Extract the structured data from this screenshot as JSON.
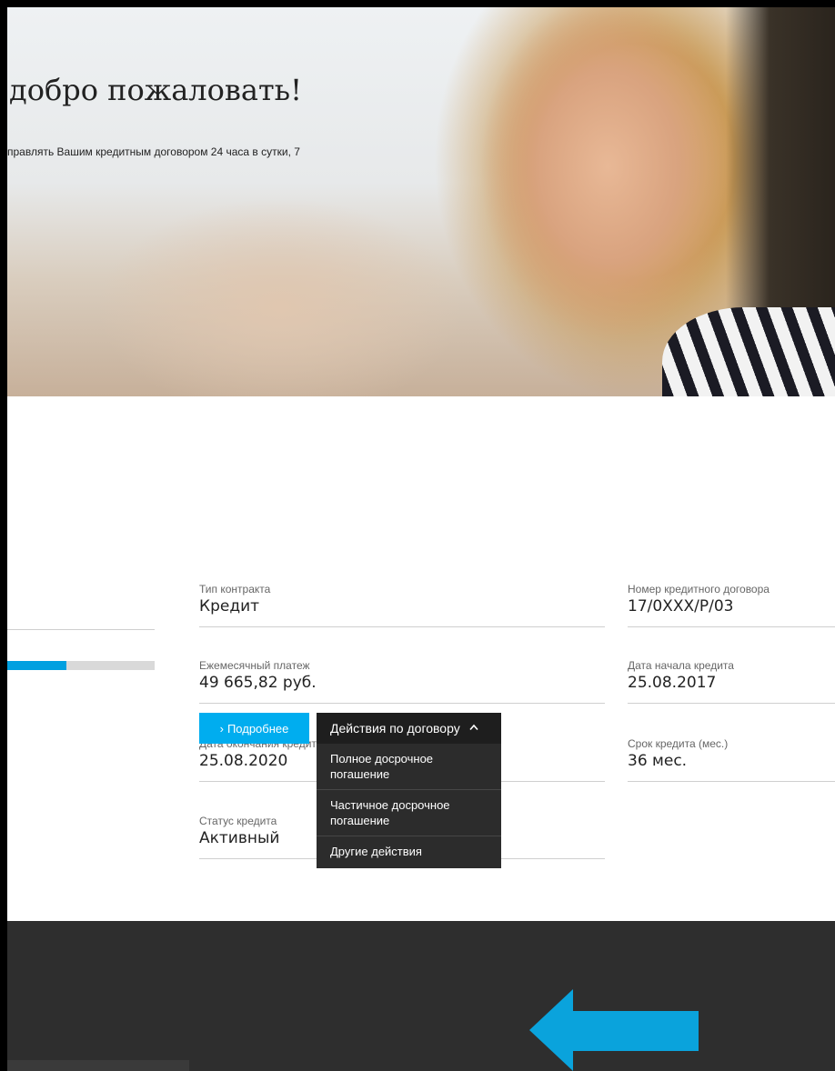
{
  "hero": {
    "title": "добро пожаловать!",
    "subtitle": "правлять Вашим кредитным договором 24 часа в сутки, 7"
  },
  "contract": {
    "progress_fraction": 0.4,
    "fields_col1": [
      {
        "label": "Тип контракта",
        "value": "Кредит"
      },
      {
        "label": "Ежемесячный платеж",
        "value": "49 665,82 руб."
      },
      {
        "label": "Дата окончания кредита",
        "value": "25.08.2020"
      },
      {
        "label": "Статус кредита",
        "value": "Активный"
      }
    ],
    "fields_col2": [
      {
        "label": "Номер кредитного договора",
        "value": "17/0XXX/P/03"
      },
      {
        "label": "Дата начала кредита",
        "value": "25.08.2017"
      },
      {
        "label": "Срок кредита (мес.)",
        "value": "36 мес."
      }
    ]
  },
  "actions": {
    "details_label": "Подробнее",
    "details_chevron": "›",
    "dropdown_label": "Действия по договору",
    "dropdown_items": [
      "Полное досрочное погашение",
      "Частичное досрочное погашение",
      "Другие действия"
    ]
  },
  "colors": {
    "accent": "#00adef",
    "dropdown_dark": "#1e1e1e",
    "footer": "#2e2e2e",
    "arrow": "#0aa3dc"
  },
  "icons": {
    "dropdown_chevron": "chevron-up-icon",
    "pointer_arrow": "arrow-left-annotation"
  }
}
